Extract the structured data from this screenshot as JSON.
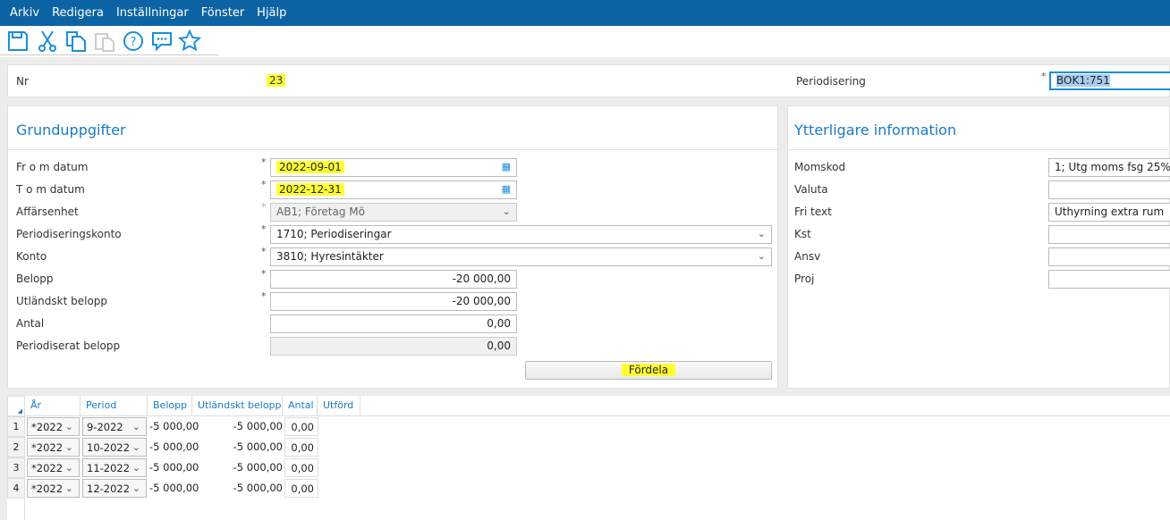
{
  "menu": [
    "Arkiv",
    "Redigera",
    "Inställningar",
    "Fönster",
    "Hjälp"
  ],
  "toolbar": {
    "icons": [
      "save-icon",
      "cut-icon",
      "copy-icon",
      "paste-icon",
      "help-icon",
      "chat-icon",
      "favorite-icon"
    ]
  },
  "header": {
    "nr_label": "Nr",
    "nr_value": "23",
    "periodisering_label": "Periodisering",
    "periodisering_value": "BOK1:751"
  },
  "grund": {
    "title": "Grunduppgifter",
    "from_label": "Fr o m datum",
    "from_value": "2022-09-01",
    "tom_label": "T o m datum",
    "tom_value": "2022-12-31",
    "affar_label": "Affärsenhet",
    "affar_value": "AB1; Företag Mö",
    "pkonto_label": "Periodiseringskonto",
    "pkonto_value": "1710; Periodiseringar",
    "konto_label": "Konto",
    "konto_value": "3810; Hyresintäkter",
    "belopp_label": "Belopp",
    "belopp_value": "-20 000,00",
    "utl_label": "Utländskt belopp",
    "utl_value": "-20 000,00",
    "antal_label": "Antal",
    "antal_value": "0,00",
    "per_label": "Periodiserat belopp",
    "per_value": "0,00",
    "fordela": "Fördela",
    "required": "*"
  },
  "ytterligare": {
    "title": "Ytterligare information",
    "fields": [
      {
        "label": "Momskod",
        "value": "1; Utg moms fsg 25%"
      },
      {
        "label": "Valuta",
        "value": ""
      },
      {
        "label": "Fri text",
        "value": "Uthyrning extra rum"
      },
      {
        "label": "Kst",
        "value": ""
      },
      {
        "label": "Ansv",
        "value": ""
      },
      {
        "label": "Proj",
        "value": ""
      }
    ]
  },
  "grid": {
    "columns": [
      "År",
      "Period",
      "Belopp",
      "Utländskt belopp",
      "Antal",
      "Utförd"
    ],
    "rows": [
      {
        "n": "1",
        "ar": "*2022",
        "period": "9-2022",
        "belopp": "-5 000,00",
        "utl": "-5 000,00",
        "antal": "0,00"
      },
      {
        "n": "2",
        "ar": "*2022",
        "period": "10-2022",
        "belopp": "-5 000,00",
        "utl": "-5 000,00",
        "antal": "0,00"
      },
      {
        "n": "3",
        "ar": "*2022",
        "period": "11-2022",
        "belopp": "-5 000,00",
        "utl": "-5 000,00",
        "antal": "0,00"
      },
      {
        "n": "4",
        "ar": "*2022",
        "period": "12-2022",
        "belopp": "-5 000,00",
        "utl": "-5 000,00",
        "antal": "0,00"
      }
    ]
  },
  "colors": {
    "menubar": "#0b63a3",
    "accent": "#1a7ac4",
    "highlight": "#ffff33"
  }
}
